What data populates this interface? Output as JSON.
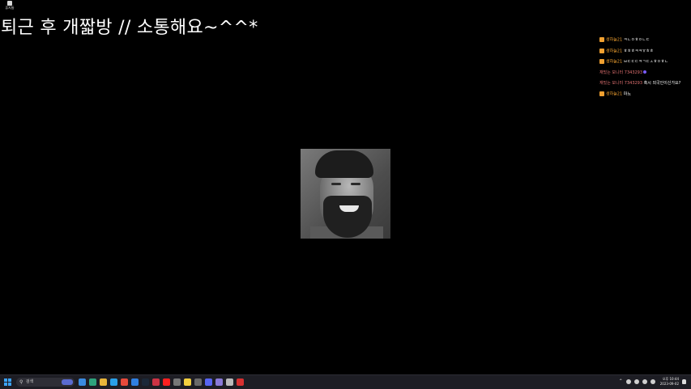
{
  "desktop": {
    "icon_label": "휴지통"
  },
  "stream_title": "퇴근 후 개짧방 // 소통해요~^^*",
  "chat": [
    {
      "user": "생하늘21",
      "message": "ㅋㄴㅇㅎㅇㄴㄷ",
      "badge": true,
      "style": "orange"
    },
    {
      "user": "생하늘21",
      "message": "ㅎㅎㅎㅋㅋㅠㅎㅎ",
      "badge": true,
      "style": "orange"
    },
    {
      "user": "생하늘21",
      "message": "ㅂㄷㄷㄷㅋㄱㄷㅅㅎㅇㅎㄴ",
      "badge": true,
      "style": "orange"
    },
    {
      "user": "재밌는 모니터 7343293",
      "message": "",
      "badge": false,
      "style": "pink",
      "emote": true
    },
    {
      "user": "재밌는 모니터 7343293",
      "message": "혹시 외국인이신가요?",
      "badge": false,
      "style": "pink"
    },
    {
      "user": "생하늘21",
      "message": "마뇨",
      "badge": true,
      "style": "orange"
    }
  ],
  "taskbar": {
    "search_placeholder": "검색",
    "apps": [
      "file-explorer-icon",
      "edge-icon",
      "folder-icon",
      "twitter-icon",
      "chrome-icon",
      "store-icon",
      "steam-icon",
      "app-icon",
      "youtube-icon",
      "app-icon",
      "kakaotalk-icon",
      "app-icon",
      "discord-icon",
      "notes-icon",
      "settings-icon",
      "recorder-icon"
    ],
    "app_colors": [
      "#3a8be0",
      "#2ea37c",
      "#e8b53a",
      "#2aa0e8",
      "#e64a3b",
      "#2f7fe0",
      "#1b2838",
      "#cc3344",
      "#ff2020",
      "#777777",
      "#f4d03f",
      "#6a6a6a",
      "#5865f2",
      "#8a7ad8",
      "#bbbbbb",
      "#d83030"
    ],
    "tray_lang": "A",
    "clock_time": "오후 10:44",
    "clock_date": "2023-09-02"
  }
}
